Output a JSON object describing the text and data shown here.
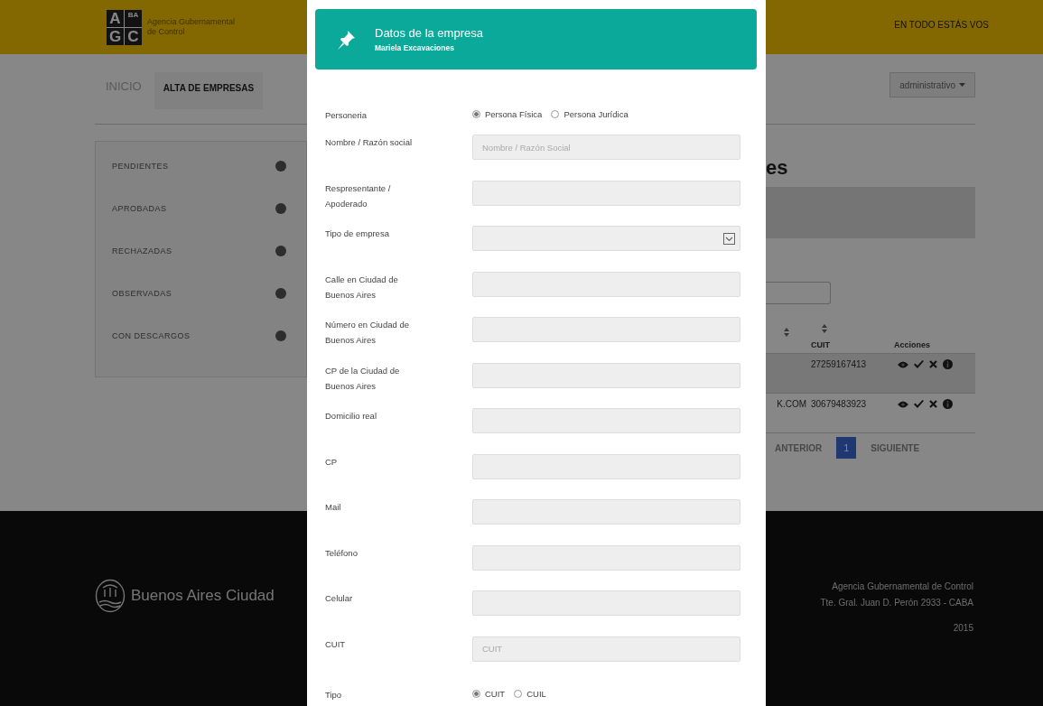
{
  "header": {
    "logo_letters": [
      "A",
      "BA",
      "G",
      "C"
    ],
    "logo_text": [
      "Agencia Gubernamental",
      "de Control"
    ],
    "slogan": "EN TODO ESTÁS VOS"
  },
  "nav": {
    "items": [
      {
        "label": "INICIO",
        "selected": false
      },
      {
        "label": "ALTA DE EMPRESAS",
        "selected": true
      }
    ],
    "user_menu": "administrativo"
  },
  "sidebar": {
    "items": [
      {
        "label": "PENDIENTES"
      },
      {
        "label": "APROBADAS"
      },
      {
        "label": "RECHAZADAS"
      },
      {
        "label": "OBSERVADAS"
      },
      {
        "label": "CON DESCARGOS"
      }
    ]
  },
  "main": {
    "heading": "es",
    "table": {
      "columns": [
        {
          "sortable": true
        },
        {
          "label": "CUIT",
          "sortable": true
        },
        {
          "label": "Acciones",
          "sortable": false
        }
      ],
      "rows": [
        {
          "cuit": "27259167413",
          "striped": true
        },
        {
          "column_1": "K.COM",
          "cuit": "30679483923",
          "striped": false
        }
      ]
    },
    "pagination": {
      "previous": "ANTERIOR",
      "pages": [
        {
          "label": "1",
          "selected": true
        }
      ],
      "next": "SIGUIENTE"
    }
  },
  "modal": {
    "title": "Datos de la empresa",
    "subtitle": "Mariela Excavaciones",
    "fields": [
      {
        "kind": "radio",
        "label": "Personeria",
        "options": [
          {
            "label": "Persona Física",
            "selected": true
          },
          {
            "label": "Persona Jurídica",
            "selected": false
          }
        ]
      },
      {
        "kind": "text",
        "label": "Nombre / Razón social",
        "placeholder": "Nombre / Razón Social"
      },
      {
        "kind": "text",
        "label": "Respresentante / Apoderado"
      },
      {
        "kind": "select",
        "label": "Tipo de empresa"
      },
      {
        "kind": "text",
        "label": "Calle en Ciudad de Buenos Aires"
      },
      {
        "kind": "text",
        "label": "Número en Ciudad de Buenos Aires"
      },
      {
        "kind": "text",
        "label": "CP de la Ciudad de Buenos Aires"
      },
      {
        "kind": "text",
        "label": "Domicilio real"
      },
      {
        "kind": "text",
        "label": "CP"
      },
      {
        "kind": "text",
        "label": "Mail"
      },
      {
        "kind": "text",
        "label": "Teléfono"
      },
      {
        "kind": "text",
        "label": "Celular"
      },
      {
        "kind": "text",
        "label": "CUIT",
        "placeholder": "CUIT"
      },
      {
        "kind": "radio",
        "label": "Tipo",
        "options": [
          {
            "label": "CUIT",
            "selected": true
          },
          {
            "label": "CUIL",
            "selected": false
          }
        ]
      }
    ]
  },
  "footer": {
    "brand": "Buenos Aires Ciudad",
    "lines": [
      "Agencia Gubernamental de Control",
      "Tte. Gral. Juan D. Perón 2933 - CABA",
      "2015"
    ]
  }
}
